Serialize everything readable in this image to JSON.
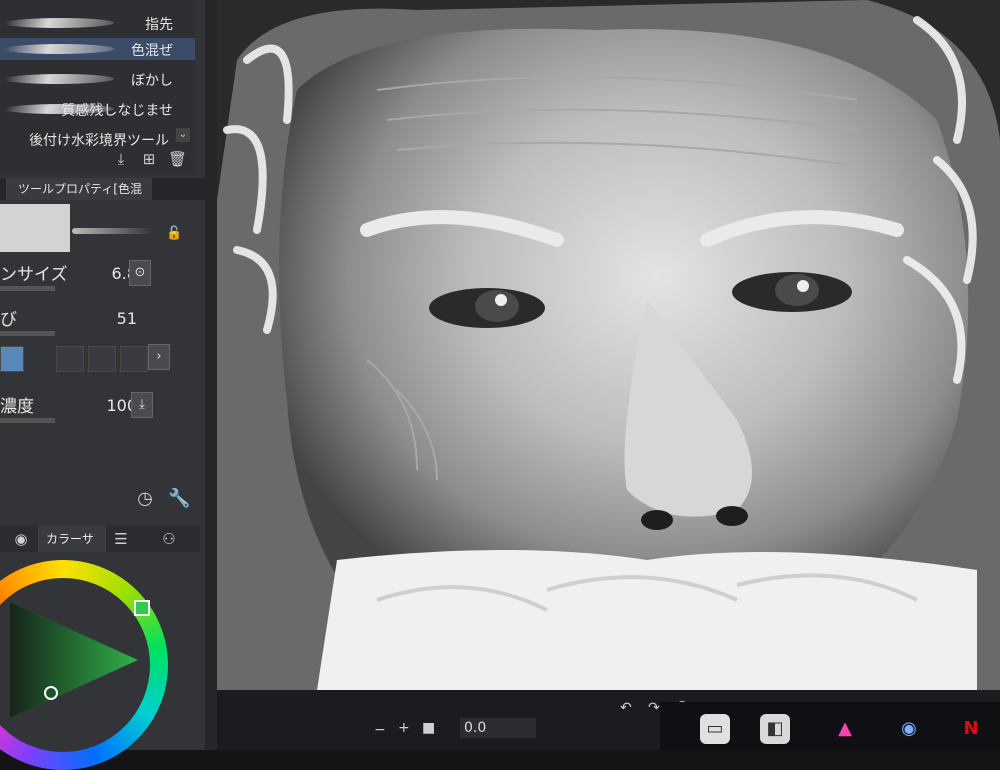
{
  "brush_list": {
    "items": [
      {
        "label": "指先",
        "selected": false
      },
      {
        "label": "色混ぜ",
        "selected": true
      },
      {
        "label": "ぼかし",
        "selected": false
      },
      {
        "label": "質感残しなじませ",
        "selected": false
      },
      {
        "label": "後付け水彩境界ツール",
        "selected": false
      }
    ],
    "action_icons": [
      "add-brush-icon",
      "duplicate-brush-icon",
      "trash-icon"
    ]
  },
  "tool_property": {
    "tab_label": "ツールプロパティ[色混ぜ]",
    "brush_size": {
      "label": "ンサイズ",
      "value": "6.8"
    },
    "blend": {
      "label": "び",
      "value": "51"
    },
    "density": {
      "label": "濃度",
      "value": "100"
    }
  },
  "swatches": [
    "#5a88b8",
    "#3a3b40",
    "#3a3b40",
    "#3a3b40",
    "#3a3b40"
  ],
  "color_panel": {
    "tab_label": "カラーサ",
    "hue_color": "#2fb24a"
  },
  "canvas": {
    "subject": "grayscale digital portrait of a bearded elderly man"
  },
  "statusbar": {
    "zoom_value": "0.0"
  },
  "colors": {
    "panel": "#333438",
    "selection": "#3c4c68",
    "accent": "#2fb24a"
  }
}
